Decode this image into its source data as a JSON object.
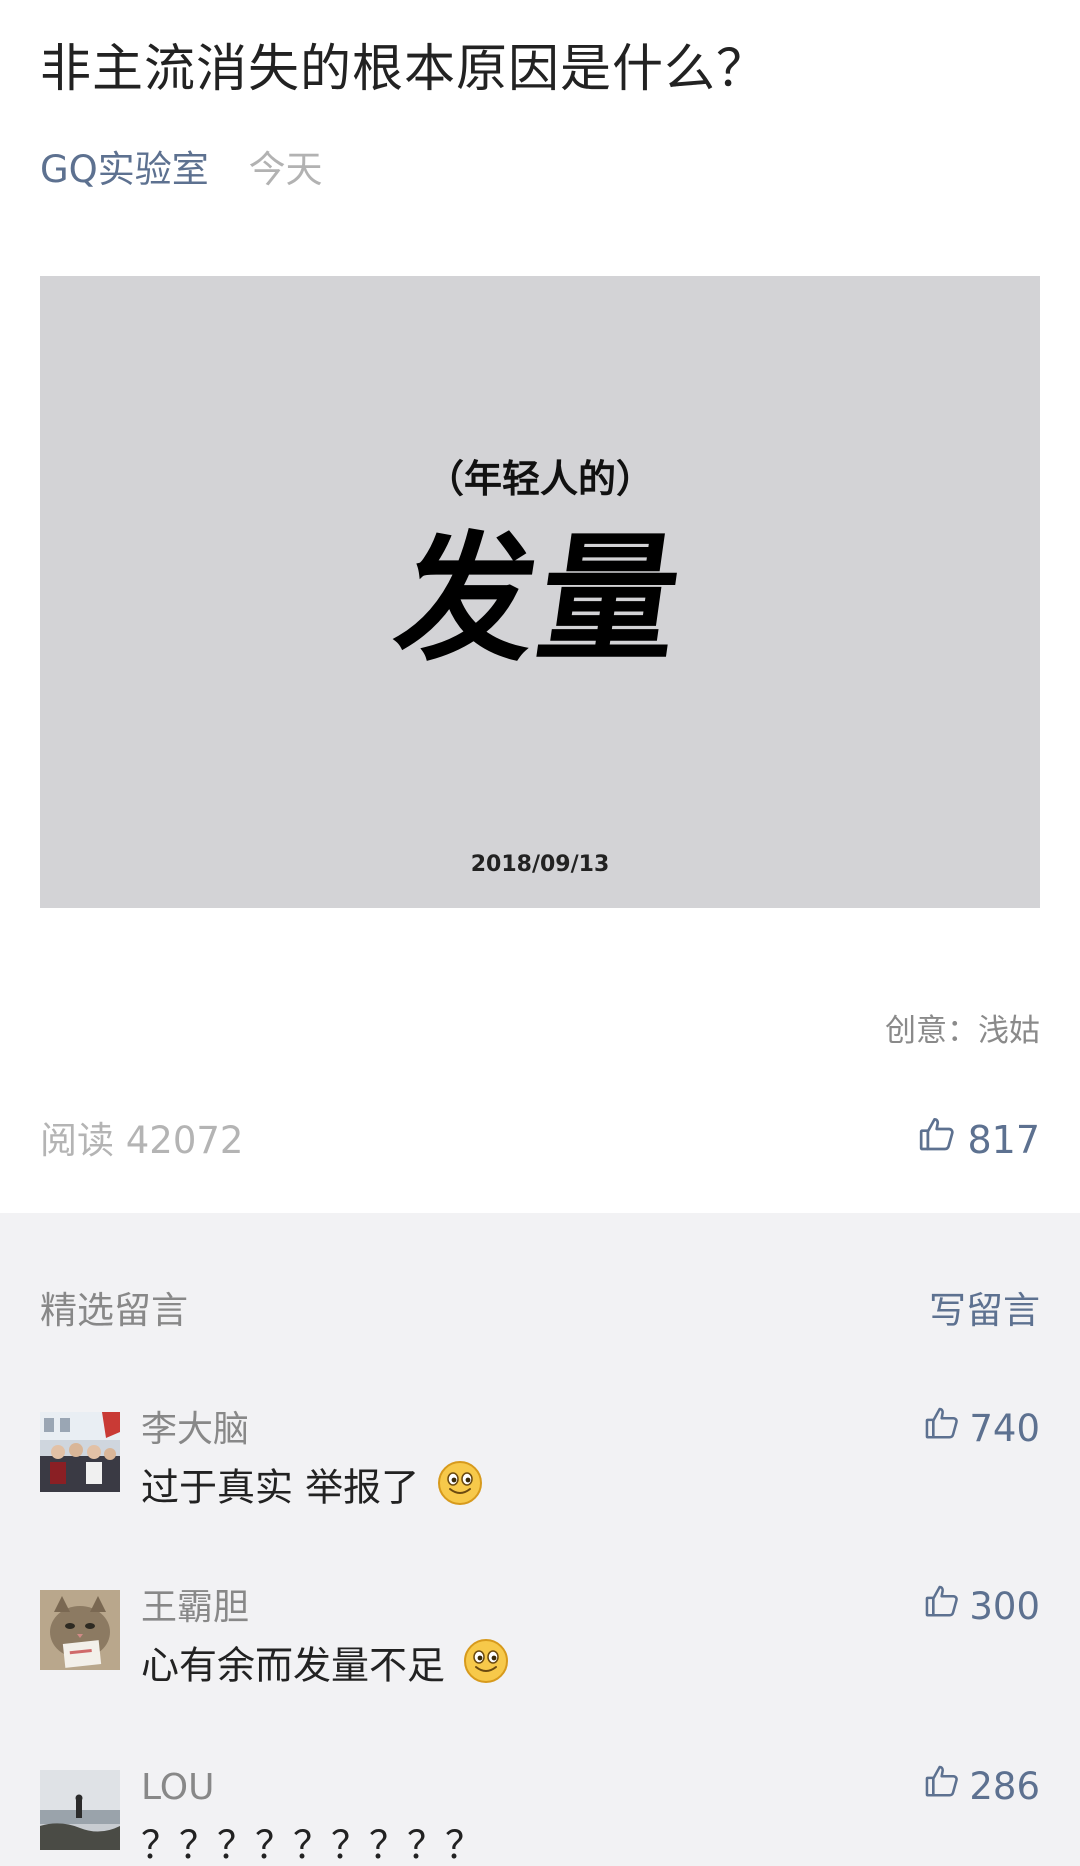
{
  "article": {
    "title": "非主流消失的根本原因是什么？",
    "source": "GQ实验室",
    "time": "今天",
    "cover": {
      "subtitle": "（年轻人的）",
      "headline": "发量",
      "date": "2018/09/13"
    },
    "credit": "创意：浅姑",
    "reads": "阅读 42072",
    "likes": "817"
  },
  "comments": {
    "title": "精选留言",
    "write_label": "写留言",
    "items": [
      {
        "nickname": "李大脑",
        "text": "过于真实 举报了",
        "likes": "740",
        "emoji": "smile-emoji"
      },
      {
        "nickname": "王霸胆",
        "text": "心有余而发量不足",
        "likes": "300",
        "emoji": "smile-emoji"
      },
      {
        "nickname": "LOU",
        "text": "？？？？？？？？？",
        "likes": "286"
      }
    ]
  },
  "colors": {
    "link_blue": "#5d7190",
    "cover_gray": "#d3d3d6",
    "comments_bg": "#f2f2f4"
  }
}
